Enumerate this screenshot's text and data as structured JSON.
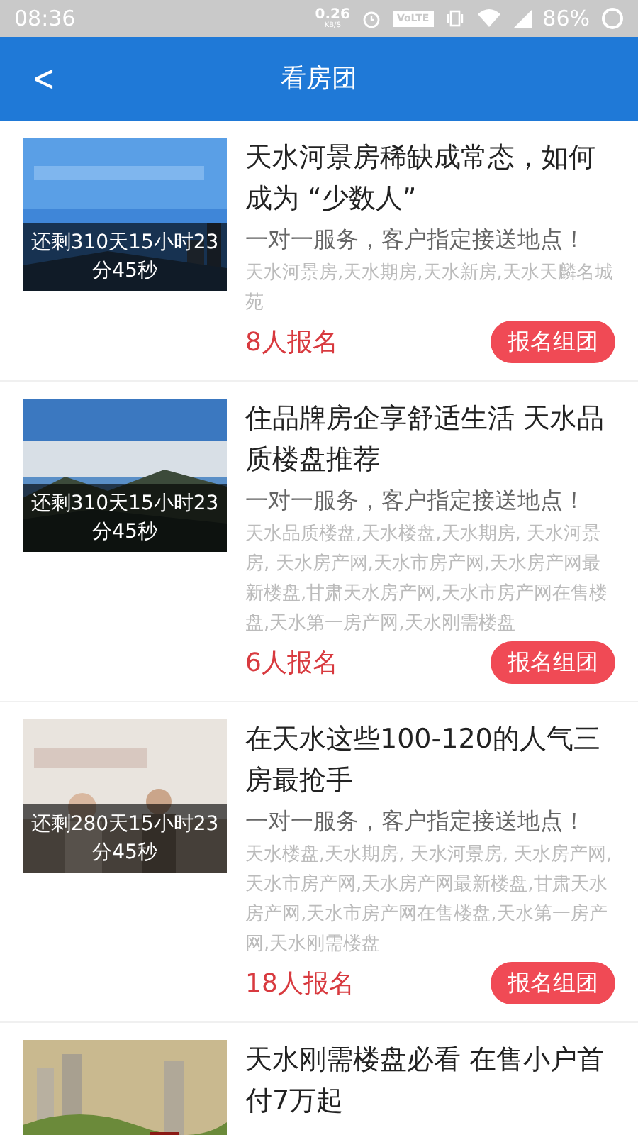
{
  "status_bar": {
    "time": "08:36",
    "speed": "0.26",
    "speed_unit": "KB/S",
    "volte": "VoLTE",
    "battery": "86%"
  },
  "header": {
    "back": "<",
    "title": "看房团"
  },
  "items": [
    {
      "title": "天水河景房稀缺成常态，如何成为 “少数人”",
      "subtitle": "一对一服务，客户指定接送地点！",
      "tags": "天水河景房,天水期房,天水新房,天水天麟名城苑",
      "count": "8人报名",
      "button": "报名组团",
      "countdown": "还剩310天15小时23分45秒"
    },
    {
      "title": "住品牌房企享舒适生活 天水品质楼盘推荐",
      "subtitle": "一对一服务，客户指定接送地点！",
      "tags": "天水品质楼盘,天水楼盘,天水期房, 天水河景房, 天水房产网,天水市房产网,天水房产网最新楼盘,甘肃天水房产网,天水市房产网在售楼盘,天水第一房产网,天水刚需楼盘",
      "count": "6人报名",
      "button": "报名组团",
      "countdown": "还剩310天15小时23分45秒"
    },
    {
      "title": "在天水这些100-120的人气三房最抢手",
      "subtitle": "一对一服务，客户指定接送地点！",
      "tags": "天水楼盘,天水期房, 天水河景房, 天水房产网,天水市房产网,天水房产网最新楼盘,甘肃天水房产网,天水市房产网在售楼盘,天水第一房产网,天水刚需楼盘",
      "count": "18人报名",
      "button": "报名组团",
      "countdown": "还剩280天15小时23分45秒"
    },
    {
      "title": "天水刚需楼盘必看 在售小户首付7万起"
    }
  ]
}
